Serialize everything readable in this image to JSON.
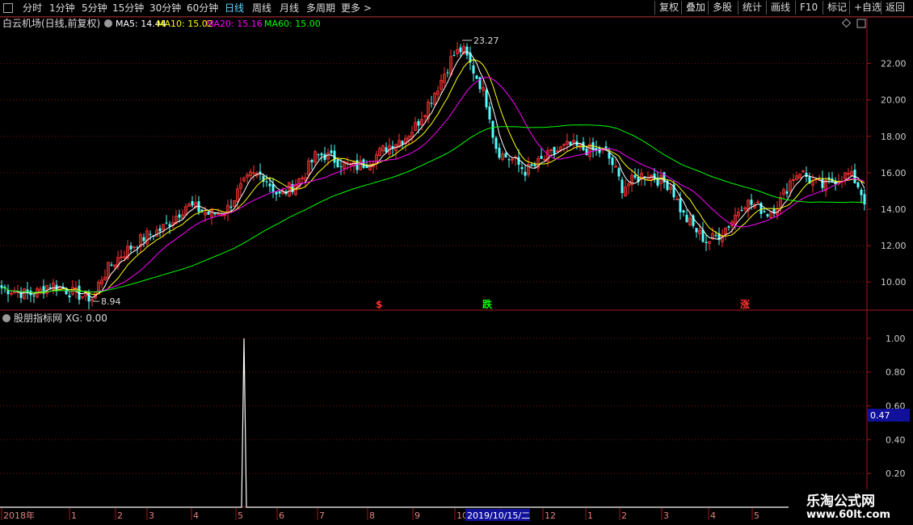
{
  "toolbar": {
    "periods": [
      "分时",
      "1分钟",
      "5分钟",
      "15分钟",
      "30分钟",
      "60分钟",
      "日线",
      "周线",
      "月线",
      "多周期",
      "更多"
    ],
    "active_period": "日线",
    "right_buttons": [
      "复权",
      "叠加",
      "多股",
      "统计",
      "画线",
      "F10",
      "标记",
      "+自选",
      "返回"
    ]
  },
  "main_panel": {
    "stock_title": "白云机场(日线,前复权)",
    "ma_labels": [
      {
        "text": "MA5: 14.44",
        "color": "#ffffff"
      },
      {
        "text": "MA10: 15.02",
        "color": "#ffff00"
      },
      {
        "text": "MA20: 15.16",
        "color": "#ff00ff"
      },
      {
        "text": "MA60: 15.00",
        "color": "#00ff00"
      }
    ],
    "y_ticks": [
      "22.00",
      "20.00",
      "18.00",
      "16.00",
      "14.00",
      "12.00",
      "10.00"
    ],
    "high_label": "23.27",
    "low_label": "8.94",
    "markers": [
      {
        "text": "$",
        "color": "#ff3030"
      },
      {
        "text": "跌",
        "color": "#00ff00"
      },
      {
        "text": "涨",
        "color": "#ff3030"
      }
    ]
  },
  "indicator_panel": {
    "title": "股朋指标网 XG: 0.00",
    "y_ticks": [
      "1.00",
      "0.80",
      "0.60",
      "0.40",
      "0.20"
    ],
    "cursor_value": "0.47"
  },
  "x_axis": {
    "labels": [
      "2018年",
      "1",
      "2",
      "3",
      "4",
      "5",
      "6",
      "7",
      "8",
      "9",
      "10",
      "11",
      "12",
      "1",
      "2",
      "3",
      "4",
      "5"
    ],
    "cursor_date": "2019/10/15/二"
  },
  "watermark": {
    "line1": "乐淘公式网",
    "line2": "www.60lt.com"
  },
  "colors": {
    "up": "#ff3333",
    "down": "#54ffff",
    "ma5": "#ffffff",
    "ma10": "#ffff00",
    "ma20": "#ff00ff",
    "ma60": "#00ff00",
    "grid": "#7a1010"
  },
  "chart_data": {
    "type": "candlestick",
    "title": "白云机场(日线,前复权)",
    "ylim": [
      8.5,
      23.8
    ],
    "y_ticks": [
      10,
      12,
      14,
      16,
      18,
      20,
      22
    ],
    "close_path": [
      [
        0,
        9.7
      ],
      [
        20,
        9.5
      ],
      [
        35,
        9.3
      ],
      [
        50,
        9.5
      ],
      [
        60,
        9.9
      ],
      [
        75,
        9.7
      ],
      [
        90,
        9.4
      ],
      [
        105,
        9.2
      ],
      [
        115,
        9.1
      ],
      [
        125,
        10.2
      ],
      [
        135,
        10.8
      ],
      [
        150,
        11.5
      ],
      [
        165,
        12.0
      ],
      [
        180,
        12.5
      ],
      [
        200,
        12.9
      ],
      [
        215,
        13.5
      ],
      [
        230,
        14.2
      ],
      [
        245,
        14.0
      ],
      [
        260,
        13.7
      ],
      [
        280,
        13.9
      ],
      [
        295,
        15.0
      ],
      [
        310,
        15.8
      ],
      [
        325,
        15.9
      ],
      [
        345,
        14.7
      ],
      [
        360,
        15.2
      ],
      [
        375,
        15.8
      ],
      [
        390,
        16.9
      ],
      [
        400,
        17.0
      ],
      [
        410,
        16.8
      ],
      [
        425,
        16.5
      ],
      [
        440,
        16.3
      ],
      [
        455,
        16.6
      ],
      [
        470,
        17.1
      ],
      [
        485,
        17.6
      ],
      [
        500,
        17.9
      ],
      [
        515,
        18.6
      ],
      [
        530,
        19.8
      ],
      [
        545,
        21.0
      ],
      [
        560,
        22.4
      ],
      [
        572,
        22.8
      ],
      [
        585,
        21.7
      ],
      [
        595,
        20.8
      ],
      [
        605,
        19.5
      ],
      [
        612,
        17.6
      ],
      [
        620,
        17.0
      ],
      [
        635,
        16.7
      ],
      [
        650,
        16.1
      ],
      [
        660,
        16.3
      ],
      [
        675,
        16.8
      ],
      [
        690,
        17.2
      ],
      [
        705,
        17.5
      ],
      [
        720,
        17.3
      ],
      [
        735,
        17.2
      ],
      [
        750,
        17.1
      ],
      [
        760,
        16.3
      ],
      [
        770,
        15.2
      ],
      [
        785,
        15.6
      ],
      [
        800,
        16.0
      ],
      [
        815,
        15.6
      ],
      [
        830,
        15.3
      ],
      [
        845,
        13.7
      ],
      [
        860,
        12.9
      ],
      [
        875,
        12.2
      ],
      [
        890,
        12.6
      ],
      [
        905,
        13.3
      ],
      [
        920,
        14.4
      ],
      [
        935,
        14.2
      ],
      [
        950,
        13.8
      ],
      [
        965,
        14.4
      ],
      [
        980,
        15.7
      ],
      [
        990,
        16.1
      ],
      [
        1005,
        15.5
      ],
      [
        1020,
        15.2
      ],
      [
        1035,
        15.7
      ],
      [
        1050,
        15.9
      ],
      [
        1060,
        15.5
      ],
      [
        1072,
        14.3
      ]
    ],
    "series": [
      {
        "name": "MA5",
        "last": 14.44,
        "color": "#ffffff"
      },
      {
        "name": "MA10",
        "last": 15.02,
        "color": "#ffff00"
      },
      {
        "name": "MA20",
        "last": 15.16,
        "color": "#ff00ff"
      },
      {
        "name": "MA60",
        "last": 15.0,
        "color": "#00ff00"
      }
    ],
    "high": 23.27,
    "low": 8.94,
    "indicator": {
      "name": "XG",
      "last": 0.0,
      "ylim": [
        0,
        1.1
      ],
      "spike_x": 302,
      "spike_value": 1.0,
      "y_ticks": [
        1.0,
        0.8,
        0.6,
        0.4,
        0.2
      ]
    }
  }
}
